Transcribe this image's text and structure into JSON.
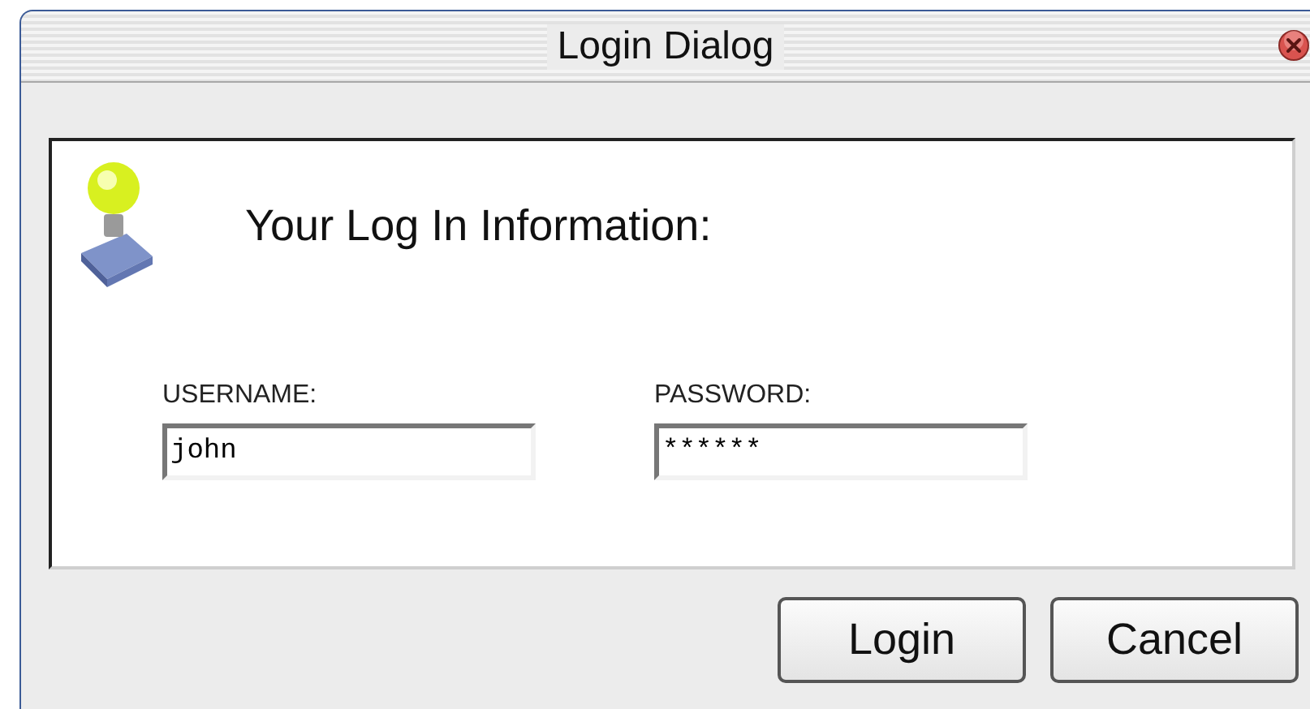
{
  "window": {
    "title": "Login Dialog"
  },
  "heading": "Your Log In Information:",
  "fields": [
    {
      "label": "USERNAME:",
      "value": "john"
    },
    {
      "label": "PASSWORD:",
      "value": "******"
    }
  ],
  "buttons": [
    "Login",
    "Cancel"
  ]
}
